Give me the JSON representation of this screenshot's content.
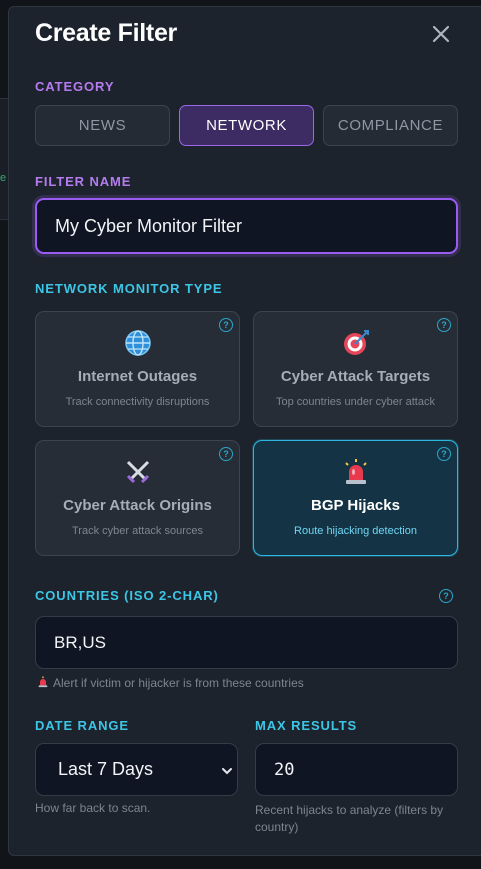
{
  "modal": {
    "title": "Create Filter",
    "close_icon": "close-icon"
  },
  "category": {
    "label": "CATEGORY",
    "options": [
      "NEWS",
      "NETWORK",
      "COMPLIANCE"
    ],
    "selected": "NETWORK"
  },
  "filter_name": {
    "label": "FILTER NAME",
    "value": "My Cyber Monitor Filter"
  },
  "monitor_type": {
    "label": "NETWORK MONITOR TYPE",
    "cards": [
      {
        "icon": "globe-icon",
        "title": "Internet Outages",
        "desc": "Track connectivity disruptions",
        "active": false
      },
      {
        "icon": "target-icon",
        "title": "Cyber Attack Targets",
        "desc": "Top countries under cyber attack",
        "active": false
      },
      {
        "icon": "crossed-swords-icon",
        "title": "Cyber Attack Origins",
        "desc": "Track cyber attack sources",
        "active": false
      },
      {
        "icon": "siren-icon",
        "title": "BGP Hijacks",
        "desc": "Route hijacking detection",
        "active": true
      }
    ],
    "help_glyph": "?"
  },
  "countries": {
    "label": "COUNTRIES (ISO 2-CHAR)",
    "value": "BR,US",
    "hint": "Alert if victim or hijacker is from these countries",
    "hint_icon": "siren-icon"
  },
  "date_range": {
    "label": "DATE RANGE",
    "value": "Last 7 Days",
    "hint": "How far back to scan."
  },
  "max_results": {
    "label": "MAX RESULTS",
    "value": "20",
    "hint": "Recent hijacks to analyze (filters by country)"
  },
  "colors": {
    "accent_purple": "#9a5cf0",
    "accent_cyan": "#2cb7e0",
    "modal_bg": "#1d232c"
  }
}
